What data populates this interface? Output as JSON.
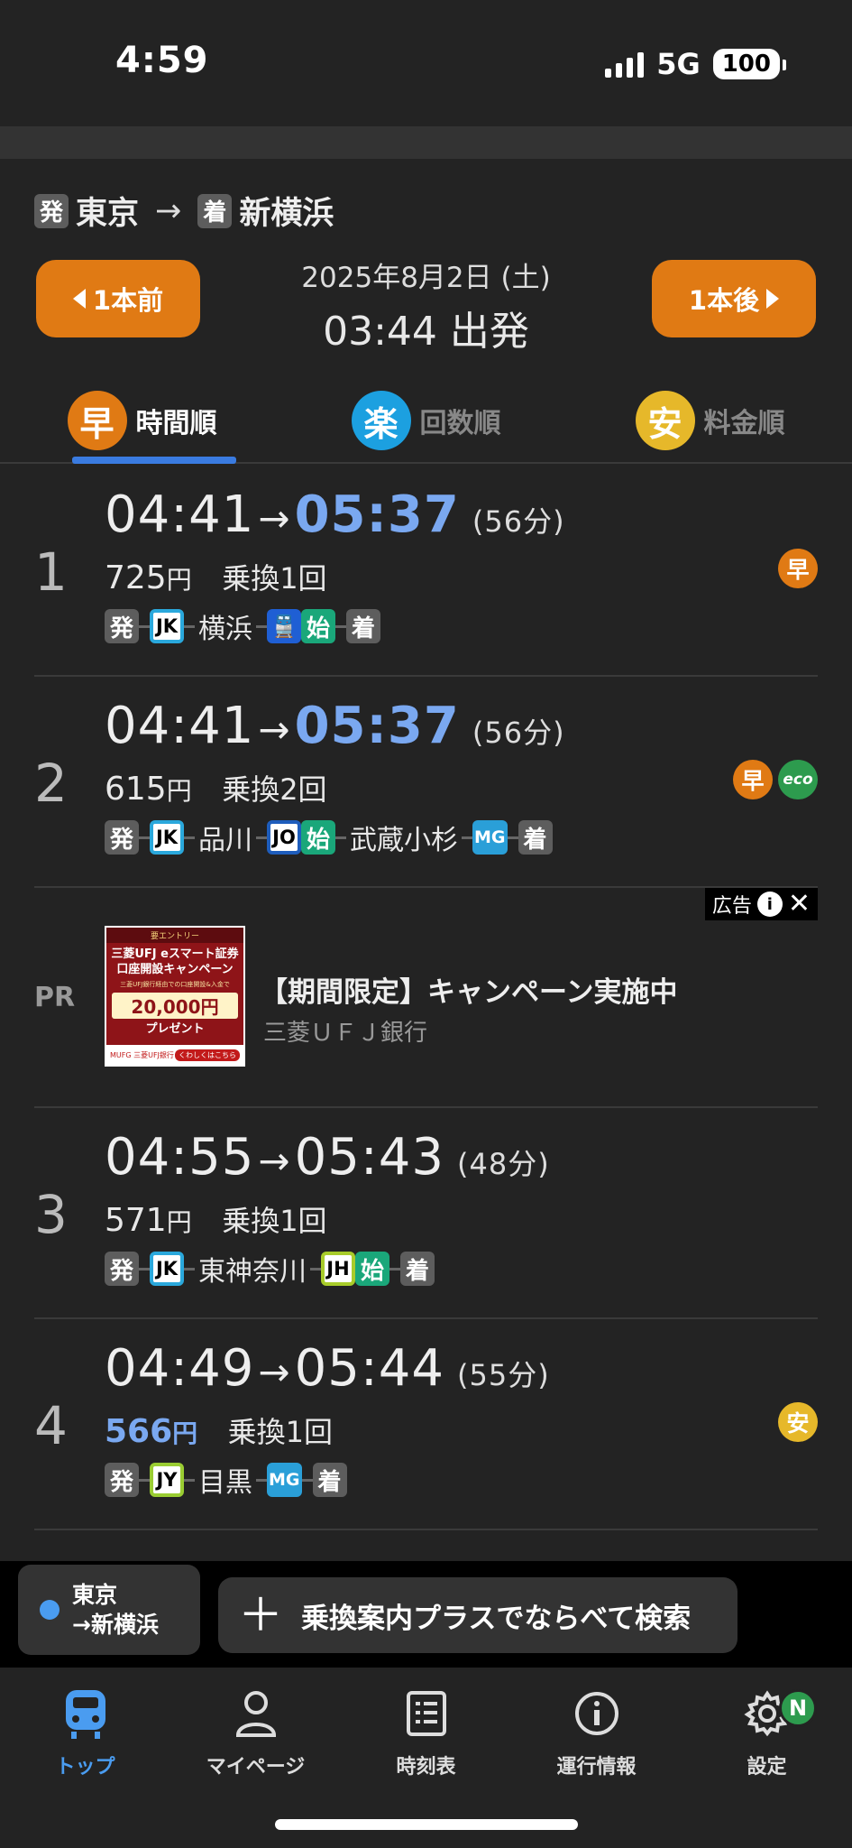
{
  "status_bar": {
    "time": "4:59",
    "network": "5G",
    "battery": "100"
  },
  "route": {
    "dep_tag": "発",
    "from": "東京",
    "arrow": "→",
    "arr_tag": "着",
    "to": "新横浜"
  },
  "nav": {
    "prev_label": "1本前",
    "next_label": "1本後",
    "date": "2025年8月2日 (土)",
    "departure": "03:44 出発"
  },
  "sort_tabs": [
    {
      "badge": "早",
      "label": "時間順",
      "color": "#e07a14",
      "active": true
    },
    {
      "badge": "楽",
      "label": "回数順",
      "color": "#1ca0e0",
      "active": false
    },
    {
      "badge": "安",
      "label": "料金順",
      "color": "#e6b82a",
      "active": false
    }
  ],
  "results": [
    {
      "num": "1",
      "dep": "04:41",
      "arr": "05:37",
      "duration": "(56分)",
      "fare": "725",
      "yen": "円",
      "transfers": "乗換1回",
      "marks": [
        "早"
      ]
    },
    {
      "num": "2",
      "dep": "04:41",
      "arr": "05:37",
      "duration": "(56分)",
      "fare": "615",
      "yen": "円",
      "transfers": "乗換2回",
      "marks": [
        "早",
        "eco"
      ]
    },
    {
      "num": "3",
      "dep": "04:55",
      "arr": "05:43",
      "duration": "(48分)",
      "fare": "571",
      "yen": "円",
      "transfers": "乗換1回",
      "marks": []
    },
    {
      "num": "4",
      "dep": "04:49",
      "arr": "05:44",
      "duration": "(55分)",
      "fare": "566",
      "yen": "円",
      "transfers": "乗換1回",
      "marks": [
        "安"
      ]
    }
  ],
  "paths": {
    "row1": {
      "dep": "発",
      "line1": "JK",
      "station1": "横浜",
      "start": "始",
      "arr": "着"
    },
    "row2": {
      "dep": "発",
      "line1": "JK",
      "station1": "品川",
      "line2": "JO",
      "start": "始",
      "station2": "武蔵小杉",
      "line3": "MG",
      "arr": "着"
    },
    "row3": {
      "dep": "発",
      "line1": "JK",
      "station1": "東神奈川",
      "line2": "JH",
      "start": "始",
      "arr": "着"
    },
    "row4": {
      "dep": "発",
      "line1": "JY",
      "station1": "目黒",
      "line2": "MG",
      "arr": "着"
    }
  },
  "ad": {
    "pr": "PR",
    "label": "広告",
    "title": "【期間限定】キャンペーン実施中",
    "advertiser": "三菱ＵＦＪ銀行",
    "banner": {
      "top": "要エントリー",
      "headline1": "三菱UFJ eスマート証券",
      "headline2": "口座開設キャンペーン",
      "note": "三菱UFJ銀行経由での口座開設&入金で",
      "amount": "20,000円",
      "present": "プレゼント",
      "brand": "MUFG 三菱UFJ銀行",
      "cta": "くわしくはこちら"
    }
  },
  "search_bar": {
    "from": "東京",
    "to": "→新横浜",
    "plus_label": "乗換案内プラスでならべて検索"
  },
  "tab_bar": [
    {
      "label": "トップ",
      "icon": "train-icon",
      "active": true
    },
    {
      "label": "マイページ",
      "icon": "person-icon",
      "active": false
    },
    {
      "label": "時刻表",
      "icon": "timetable-icon",
      "active": false
    },
    {
      "label": "運行情報",
      "icon": "info-icon",
      "active": false
    },
    {
      "label": "設定",
      "icon": "gear-icon",
      "active": false,
      "badge": "N"
    }
  ]
}
